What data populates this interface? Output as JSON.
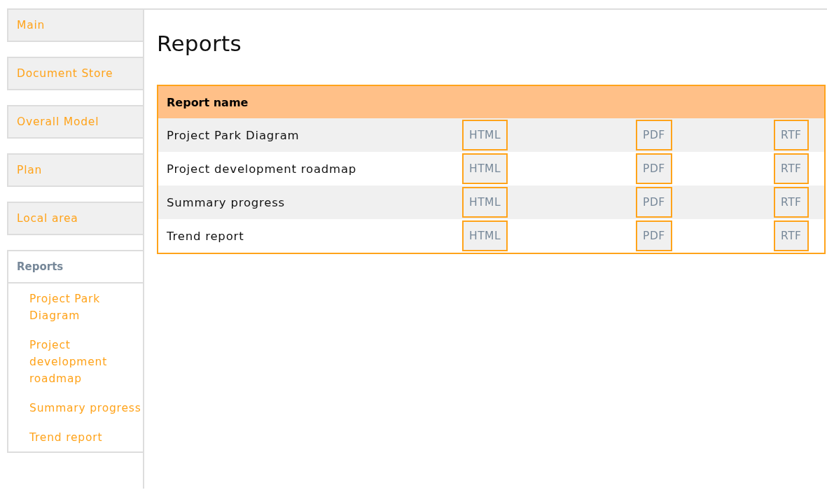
{
  "sidebar": {
    "items": [
      {
        "label": "Main",
        "selected": false
      },
      {
        "label": "Document Store",
        "selected": false
      },
      {
        "label": "Overall Model",
        "selected": false
      },
      {
        "label": "Plan",
        "selected": false
      },
      {
        "label": "Local area",
        "selected": false
      },
      {
        "label": "Reports",
        "selected": true,
        "children": [
          {
            "label": "Project Park Diagram"
          },
          {
            "label": "Project development roadmap"
          },
          {
            "label": "Summary progress"
          },
          {
            "label": "Trend report"
          }
        ]
      }
    ]
  },
  "page": {
    "title": "Reports"
  },
  "table": {
    "columns": [
      "Report name"
    ],
    "rows": [
      {
        "name": "Project Park Diagram",
        "formats": [
          "HTML",
          "PDF",
          "RTF"
        ]
      },
      {
        "name": "Project development roadmap",
        "formats": [
          "HTML",
          "PDF",
          "RTF"
        ]
      },
      {
        "name": "Summary progress",
        "formats": [
          "HTML",
          "PDF",
          "RTF"
        ]
      },
      {
        "name": "Trend report",
        "formats": [
          "HTML",
          "PDF",
          "RTF"
        ]
      }
    ]
  }
}
